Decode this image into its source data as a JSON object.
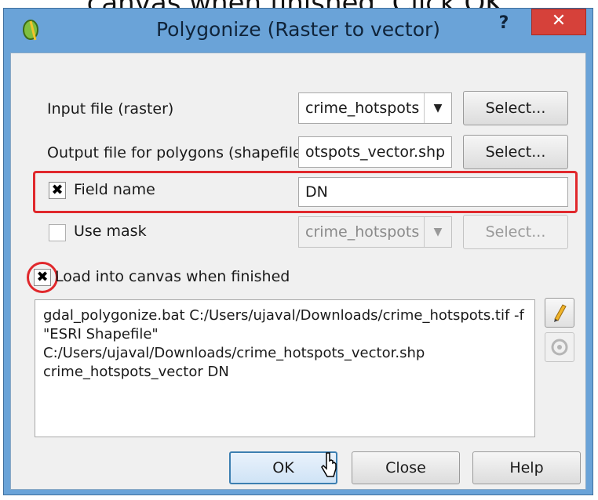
{
  "caption": "canvas when finished. Click OK.",
  "window": {
    "title": "Polygonize (Raster to vector)",
    "help_label": "?",
    "close_label": "✕"
  },
  "form": {
    "input_label": "Input file (raster)",
    "input_value": "crime_hotspots",
    "output_label": "Output file for polygons (shapefile)",
    "output_value": "otspots_vector.shp",
    "select_label": "Select...",
    "field_name_label": "Field name",
    "field_name_value": "DN",
    "use_mask_label": "Use mask",
    "mask_value": "crime_hotspots",
    "load_label": "Load into canvas when finished",
    "command": "gdal_polygonize.bat C:/Users/ujaval/Downloads/crime_hotspots.tif -f\n\"ESRI Shapefile\"\nC:/Users/ujaval/Downloads/crime_hotspots_vector.shp\ncrime_hotspots_vector DN"
  },
  "buttons": {
    "ok": "OK",
    "close": "Close",
    "help": "Help"
  },
  "checkbox_mark": "✖",
  "dropdown_arrow": "▼"
}
